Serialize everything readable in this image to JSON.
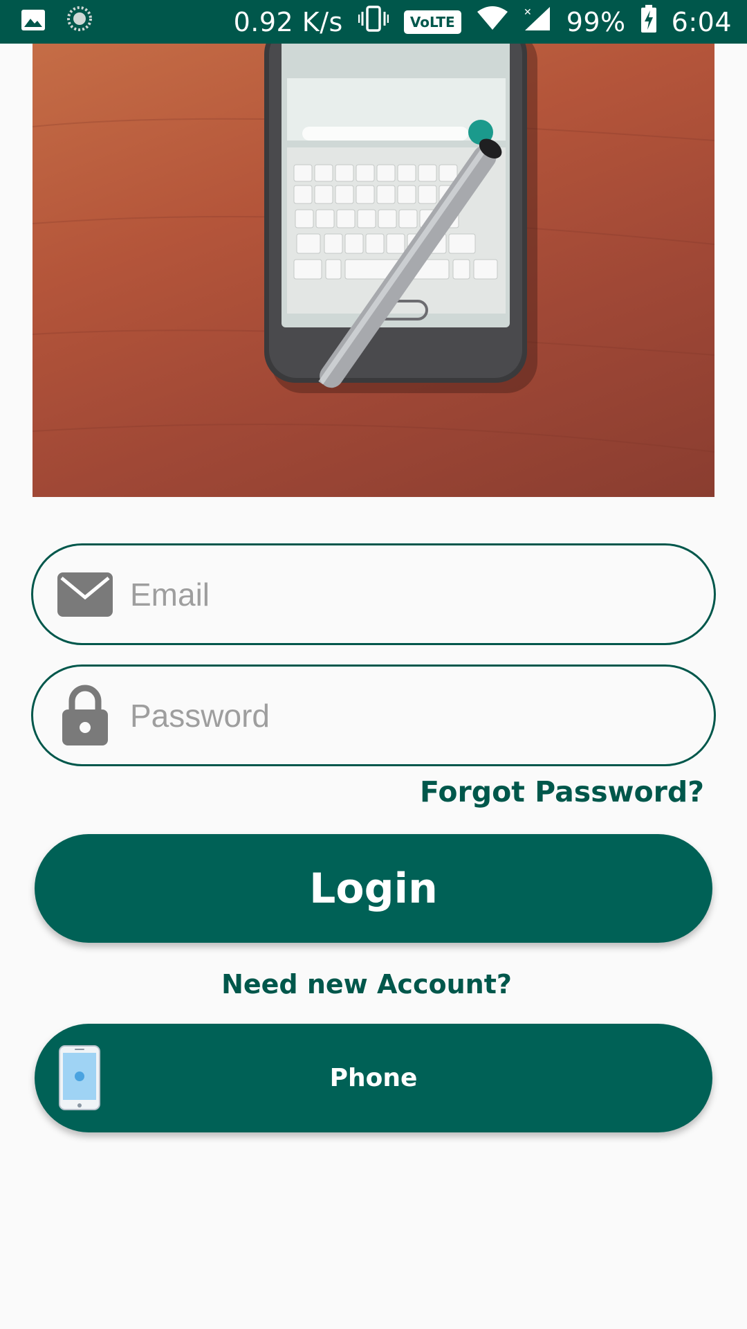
{
  "status_bar": {
    "net_speed": "0.92 K/s",
    "volte": "VoLTE",
    "battery": "99%",
    "time": "6:04",
    "icons": [
      "image-icon",
      "sync-icon",
      "vibrate-icon",
      "wifi-icon",
      "signal-icon",
      "battery-charging-icon"
    ]
  },
  "hero": {
    "icon": "phone-on-desk-photo"
  },
  "login_form": {
    "email": {
      "placeholder": "Email",
      "value": "",
      "icon": "mail-icon"
    },
    "password": {
      "placeholder": "Password",
      "value": "",
      "icon": "lock-icon"
    },
    "forgot_password": "Forgot Password?",
    "login_button": "Login",
    "need_account": "Need new Account?",
    "phone_button": "Phone",
    "phone_icon": "smartphone-icon"
  },
  "colors": {
    "primary": "#00574b",
    "button": "#006156",
    "background": "#fafafa",
    "placeholder": "#9e9e9e"
  }
}
